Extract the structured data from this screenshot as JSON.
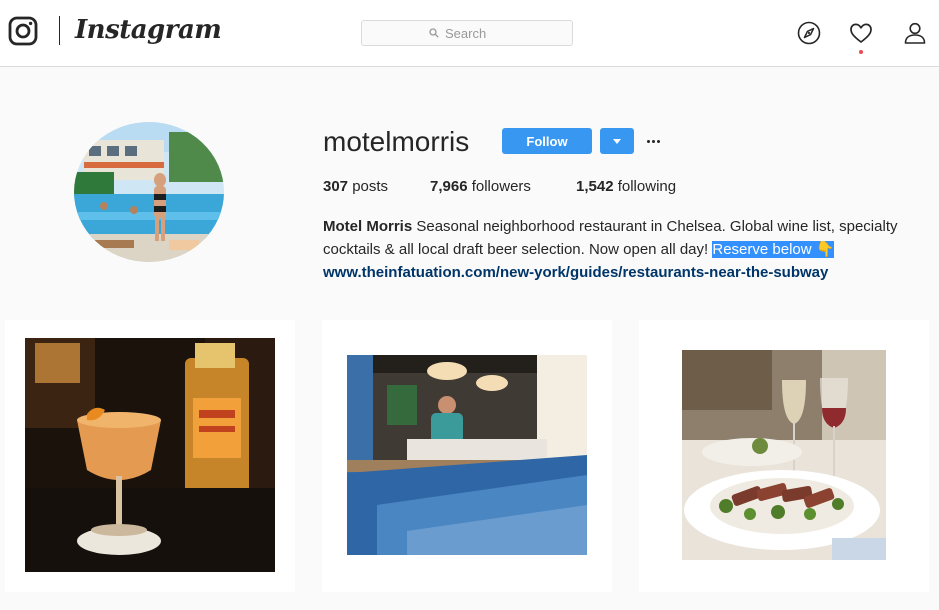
{
  "header": {
    "brand": "Instagram",
    "search": {
      "placeholder": "Search",
      "value": ""
    },
    "icons": [
      "explore-compass-icon",
      "activity-heart-icon",
      "profile-person-icon"
    ],
    "colors": {
      "notification_dot": "#ed4956"
    }
  },
  "profile": {
    "username": "motelmorris",
    "follow_label": "Follow",
    "stats": {
      "posts": {
        "count": "307",
        "label": "posts"
      },
      "followers": {
        "count": "7,966",
        "label": "followers"
      },
      "following": {
        "count": "1,542",
        "label": "following"
      }
    },
    "bio": {
      "name": "Motel Morris",
      "text": "Seasonal neighborhood restaurant in Chelsea. Global wine list, specialty cocktails & all local draft beer selection. Now open all day!",
      "highlight": "Reserve below 👇",
      "link": "www.theinfatuation.com/new-york/guides/restaurants-near-the-subway"
    },
    "colors": {
      "accent": "#3897f0",
      "link": "#003569",
      "selection": "#3390ff"
    }
  },
  "posts": [
    {
      "subject": "cocktail-with-orange-peel-and-bottle"
    },
    {
      "subject": "chef-at-kitchen-pass-window"
    },
    {
      "subject": "steak-salad-and-wine-glasses"
    }
  ]
}
